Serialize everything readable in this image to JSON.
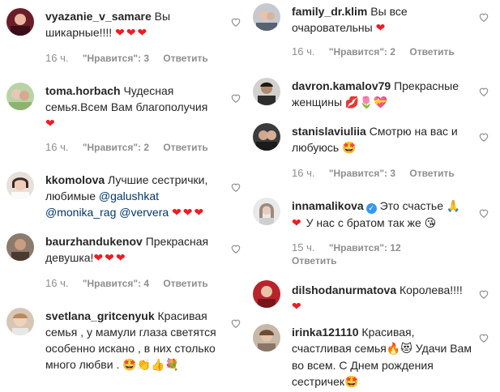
{
  "colors": {
    "username": "#262626",
    "meta": "#8e8e8e",
    "heart": "#ed1c24",
    "mention": "#00376b",
    "verified": "#3897f0"
  },
  "left_comments": [
    {
      "username": "vyazanie_v_samare",
      "text": "Вы шикарные!!!!",
      "emoji": "❤❤❤",
      "time": "16 ч.",
      "likes": "\"Нравится\": 3",
      "reply": "Ответить"
    },
    {
      "username": "toma.horbach",
      "text": "Чудесная семья.Всем Вам благополучия",
      "emoji": "❤",
      "time": "16 ч.",
      "likes": "\"Нравится\": 2",
      "reply": "Ответить"
    },
    {
      "username": "kkomolova",
      "text": "Лучшие сестрички, любимые",
      "mentions": [
        "@galushkat",
        "@monika_rag",
        "@ververa"
      ],
      "emoji": "❤❤❤"
    },
    {
      "username": "baurzhandukenov",
      "text": "Прекрасная девушка!",
      "emoji": "❤❤❤",
      "time": "16 ч.",
      "likes": "\"Нравится\": 4",
      "reply": "Ответить"
    },
    {
      "username": "svetlana_gritcenyuk",
      "text": "Красивая семья , у мамули глаза светятся особенно искано , в них столько много любви .",
      "emoji": "🤩👏👍💐"
    }
  ],
  "right_comments": [
    {
      "username": "family_dr.klim",
      "text": "Вы все очаровательны",
      "emoji": "❤",
      "time": "16 ч.",
      "likes": "\"Нравится\": 2",
      "reply": "Ответить"
    },
    {
      "username": "davron.kamalov79",
      "text": "Прекрасные женщины",
      "emoji": "💋🌷💝"
    },
    {
      "username": "stanislaviuliia",
      "text": "Смотрю на вас и любуюсь",
      "emoji": "🤩",
      "time": "16 ч.",
      "likes": "\"Нравится\": 3",
      "reply": "Ответить"
    },
    {
      "username": "innamalikova",
      "text": "Это счастье",
      "emoji_after_text": "🙏",
      "text2": "У нас с братом так же",
      "emoji_lead": "❤",
      "emoji": "😘",
      "time": "15 ч.",
      "likes": "\"Нравится\": 12",
      "reply": "Ответить"
    },
    {
      "username": "dilshodanurmatova",
      "text": "Королева!!!!",
      "emoji": "❤"
    },
    {
      "username": "irinka121110",
      "text": "Красивая, счастливая семья",
      "emoji_mid": "🔥😻",
      "text2": "Удачи Вам во всем. С Днем рождения сестричек",
      "emoji": "🤩"
    }
  ]
}
